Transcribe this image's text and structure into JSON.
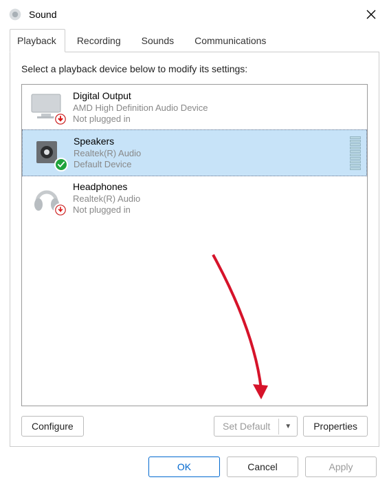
{
  "window": {
    "title": "Sound"
  },
  "tabs": {
    "items": [
      {
        "label": "Playback",
        "active": true
      },
      {
        "label": "Recording"
      },
      {
        "label": "Sounds"
      },
      {
        "label": "Communications"
      }
    ]
  },
  "panel": {
    "instruction": "Select a playback device below to modify its settings:",
    "devices": [
      {
        "title": "Digital Output",
        "driver": "AMD High Definition Audio Device",
        "status": "Not plugged in",
        "state": "unplugged",
        "selected": false,
        "icon": "monitor"
      },
      {
        "title": "Speakers",
        "driver": "Realtek(R) Audio",
        "status": "Default Device",
        "state": "default",
        "selected": true,
        "icon": "speaker"
      },
      {
        "title": "Headphones",
        "driver": "Realtek(R) Audio",
        "status": "Not plugged in",
        "state": "unplugged",
        "selected": false,
        "icon": "headphones"
      }
    ],
    "buttons": {
      "configure": "Configure",
      "set_default": "Set Default",
      "properties": "Properties"
    }
  },
  "footer": {
    "ok": "OK",
    "cancel": "Cancel",
    "apply": "Apply"
  }
}
